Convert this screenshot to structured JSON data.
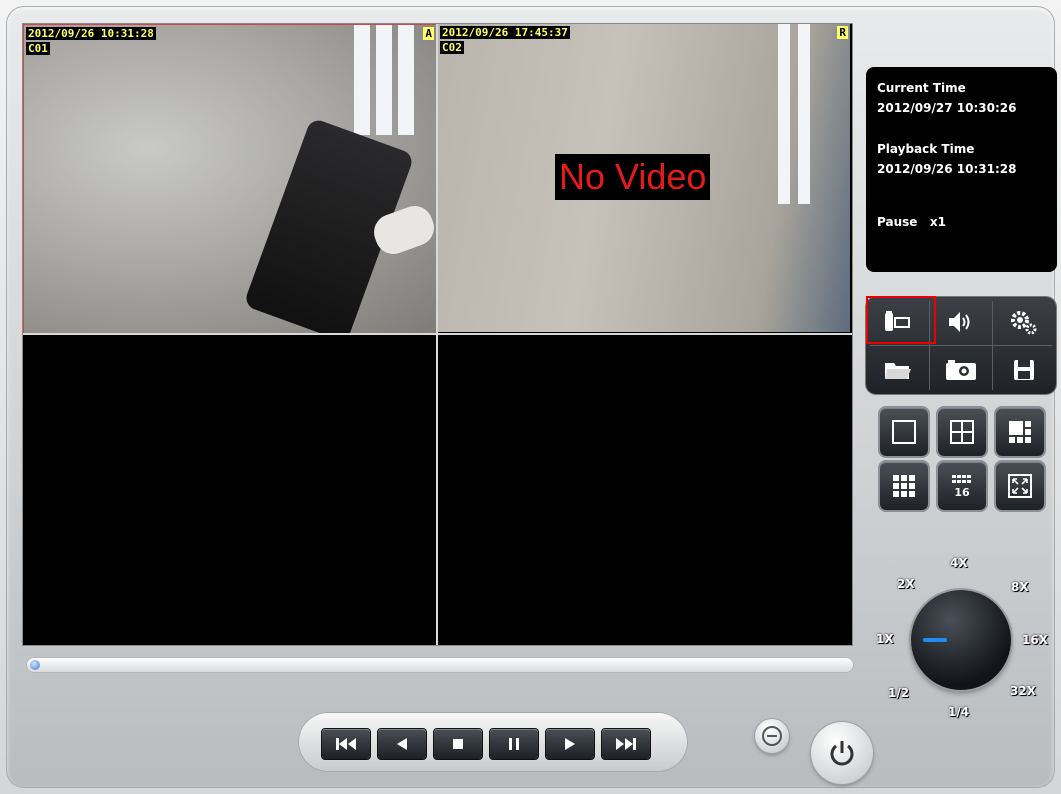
{
  "cameras": [
    {
      "timestamp": "2012/09/26 10:31:28",
      "id": "C01",
      "flag": "A"
    },
    {
      "timestamp": "2012/09/26 17:45:37",
      "id": "C02",
      "flag": "R",
      "overlay": "No Video"
    }
  ],
  "info": {
    "current_time_label": "Current Time",
    "current_time": "2012/09/27 10:30:26",
    "playback_time_label": "Playback Time",
    "playback_time": "2012/09/26 10:31:28",
    "status": "Pause   x1"
  },
  "tools": [
    "backup-icon",
    "volume-icon",
    "settings-icon",
    "folder-icon",
    "snapshot-icon",
    "save-icon"
  ],
  "layouts": [
    "layout-1-icon",
    "layout-4-icon",
    "layout-6-icon",
    "layout-9-icon",
    "layout-16-icon",
    "fullscreen-icon"
  ],
  "speed": {
    "labels": {
      "s4x": "4X",
      "s2x": "2X",
      "s8x": "8X",
      "s1x": "1X",
      "s16x": "16X",
      "s1_2": "1/2",
      "s32x": "32X",
      "s1_4": "1/4"
    },
    "selected": "1X"
  },
  "playback_position": 0,
  "transport": [
    "skip-back-icon",
    "play-reverse-icon",
    "stop-icon",
    "pause-icon",
    "play-icon",
    "skip-forward-icon"
  ],
  "colors": {
    "accent": "#1e8ff0",
    "osd_text": "#ffff66",
    "no_video": "#e51b1b",
    "selected_border": "#d24646"
  }
}
